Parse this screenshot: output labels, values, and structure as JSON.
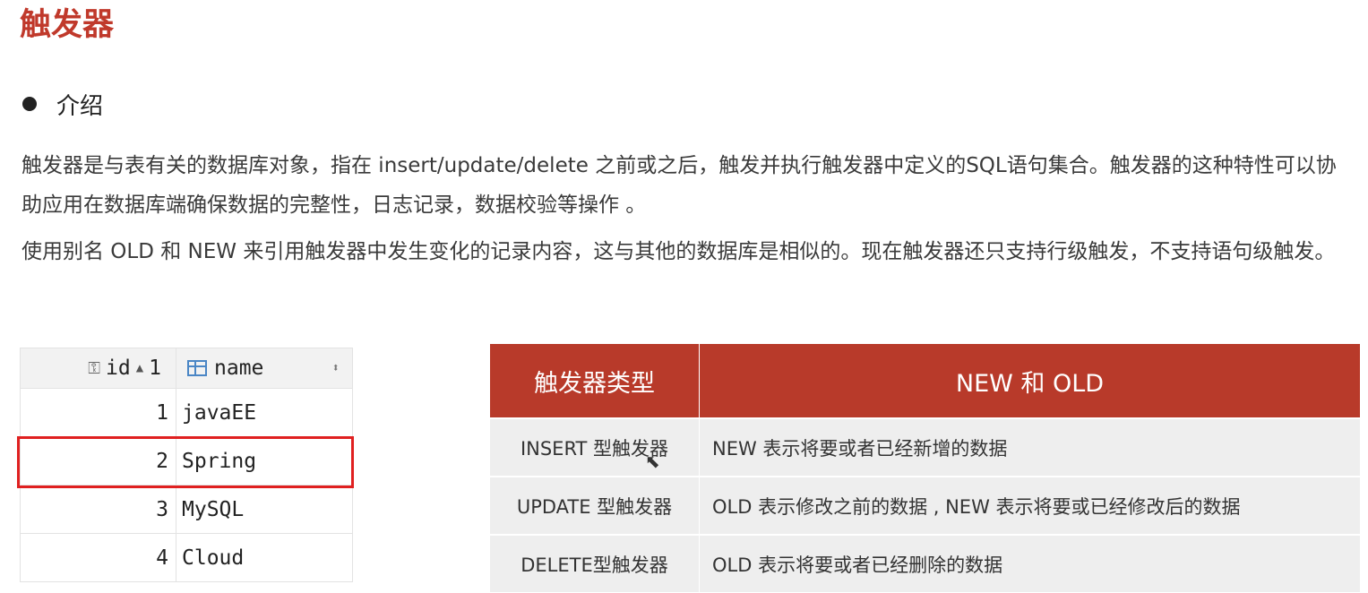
{
  "title": "触发器",
  "section": "介绍",
  "paragraphs": [
    "触发器是与表有关的数据库对象，指在 insert/update/delete 之前或之后，触发并执行触发器中定义的SQL语句集合。触发器的这种特性可以协助应用在数据库端确保数据的完整性，日志记录，数据校验等操作 。",
    "使用别名 OLD 和 NEW 来引用触发器中发生变化的记录内容，这与其他的数据库是相似的。现在触发器还只支持行级触发，不支持语句级触发。"
  ],
  "grid": {
    "columns": [
      "id",
      "name"
    ],
    "sort_index": "1",
    "rows": [
      {
        "id": "1",
        "name": "javaEE"
      },
      {
        "id": "2",
        "name": "Spring"
      },
      {
        "id": "3",
        "name": "MySQL"
      },
      {
        "id": "4",
        "name": "Cloud"
      }
    ],
    "selected_row": 2,
    "selection_color": "#e02020"
  },
  "trigger_table": {
    "headers": [
      "触发器类型",
      "NEW 和 OLD"
    ],
    "rows": [
      {
        "type": "INSERT 型触发器",
        "desc": "NEW 表示将要或者已经新增的数据"
      },
      {
        "type": "UPDATE 型触发器",
        "desc": "OLD 表示修改之前的数据 , NEW 表示将要或已经修改后的数据"
      },
      {
        "type": "DELETE型触发器",
        "desc": "OLD 表示将要或者已经删除的数据"
      }
    ],
    "header_color": "#b83a2a"
  }
}
